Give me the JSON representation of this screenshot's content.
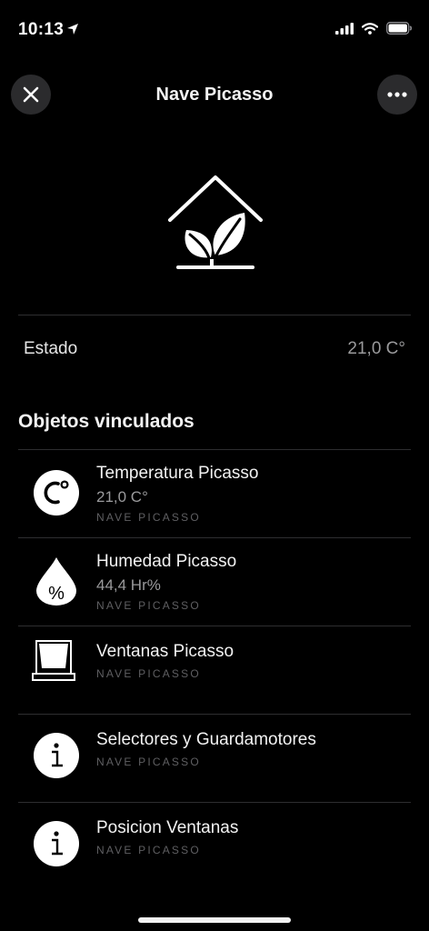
{
  "status_bar": {
    "time": "10:13"
  },
  "header": {
    "title": "Nave Picasso"
  },
  "estado": {
    "label": "Estado",
    "value": "21,0 C°"
  },
  "linked": {
    "title": "Objetos vinculados",
    "items": [
      {
        "title": "Temperatura Picasso",
        "value": "21,0 C°",
        "subtitle": "NAVE PICASSO",
        "icon": "celsius-icon"
      },
      {
        "title": "Humedad Picasso",
        "value": "44,4 Hr%",
        "subtitle": "NAVE PICASSO",
        "icon": "humidity-drop-icon"
      },
      {
        "title": "Ventanas Picasso",
        "value": "",
        "subtitle": "NAVE PICASSO",
        "icon": "window-icon"
      },
      {
        "title": "Selectores y Guardamotores",
        "value": "",
        "subtitle": "NAVE PICASSO",
        "icon": "info-icon"
      },
      {
        "title": "Posicion Ventanas",
        "value": "",
        "subtitle": "NAVE PICASSO",
        "icon": "info-icon"
      }
    ]
  },
  "icons": {
    "hero": "greenhouse-plant-icon"
  },
  "colors": {
    "background": "#000000",
    "button_bg": "#2b2b2d",
    "secondary_text": "#9a9a9c",
    "tertiary_text": "#5f5f62",
    "divider": "#2e2e30"
  }
}
